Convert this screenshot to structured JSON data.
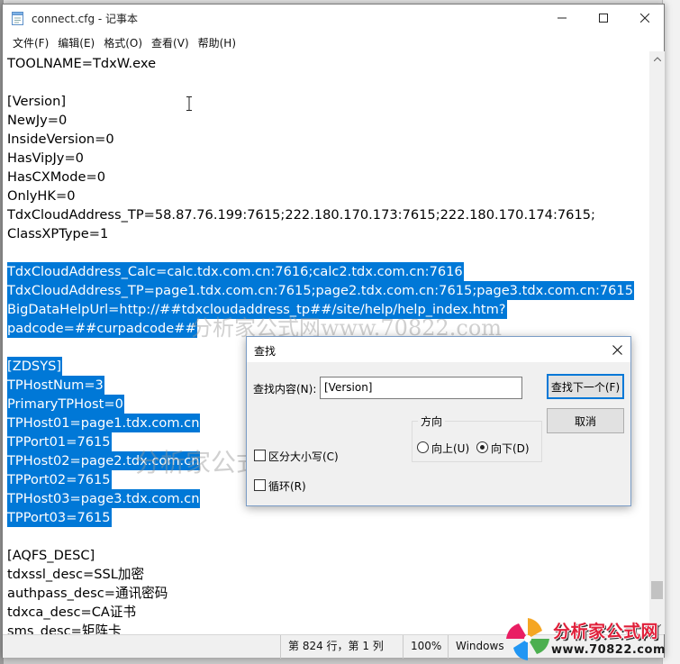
{
  "window": {
    "title": "connect.cfg - 记事本",
    "icon": "notepad-icon"
  },
  "menu": [
    {
      "label": "文件(F)"
    },
    {
      "label": "编辑(E)"
    },
    {
      "label": "格式(O)"
    },
    {
      "label": "查看(V)"
    },
    {
      "label": "帮助(H)"
    }
  ],
  "editor": {
    "lines": [
      {
        "text": "TOOLNAME=TdxW.exe",
        "selected": false
      },
      {
        "text": "",
        "selected": false
      },
      {
        "text": "[Version]",
        "selected": false
      },
      {
        "text": "NewJy=0",
        "selected": false
      },
      {
        "text": "InsideVersion=0",
        "selected": false
      },
      {
        "text": "HasVipJy=0",
        "selected": false
      },
      {
        "text": "HasCXMode=0",
        "selected": false
      },
      {
        "text": "OnlyHK=0",
        "selected": false
      },
      {
        "text": "TdxCloudAddress_TP=58.87.76.199:7615;222.180.170.173:7615;222.180.170.174:7615;",
        "selected": false
      },
      {
        "text": "ClassXPType=1",
        "selected": false
      },
      {
        "text": "",
        "selected": false
      },
      {
        "text": "TdxCloudAddress_Calc=calc.tdx.com.cn:7616;calc2.tdx.com.cn:7616",
        "selected": true
      },
      {
        "text": "TdxCloudAddress_TP=page1.tdx.com.cn:7615;page2.tdx.com.cn:7615;page3.tdx.com.cn:7615",
        "selected": true
      },
      {
        "text": "BigDataHelpUrl=http://##tdxcloudaddress_tp##/site/help/help_index.htm?",
        "selected": true
      },
      {
        "text": "padcode=##curpadcode##",
        "selected": true
      },
      {
        "text": "",
        "selected": false
      },
      {
        "text": "[ZDSYS]",
        "selected": true
      },
      {
        "text": "TPHostNum=3",
        "selected": true
      },
      {
        "text": "PrimaryTPHost=0",
        "selected": true
      },
      {
        "text": "TPHost01=page1.tdx.com.cn",
        "selected": true
      },
      {
        "text": "TPPort01=7615",
        "selected": true
      },
      {
        "text": "TPHost02=page2.tdx.com.cn",
        "selected": true
      },
      {
        "text": "TPPort02=7615",
        "selected": true
      },
      {
        "text": "TPHost03=page3.tdx.com.cn",
        "selected": true
      },
      {
        "text": "TPPort03=7615",
        "selected": true
      },
      {
        "text": "",
        "selected": false
      },
      {
        "text": "[AQFS_DESC]",
        "selected": false
      },
      {
        "text": "tdxssl_desc=SSL加密",
        "selected": false
      },
      {
        "text": "authpass_desc=通讯密码",
        "selected": false
      },
      {
        "text": "tdxca_desc=CA证书",
        "selected": false
      },
      {
        "text": "sms_desc=矩阵卡",
        "selected": false
      }
    ],
    "selection_color": "#0078d7"
  },
  "status": {
    "position": "第 824 行，第 1 列",
    "zoom": "100%",
    "encoding": "Windows"
  },
  "find_dialog": {
    "title": "查找",
    "find_label": "查找内容(N):",
    "find_value": "[Version]",
    "find_next_label": "查找下一个(F)",
    "cancel_label": "取消",
    "direction_label": "方向",
    "up_label": "向上(U)",
    "down_label": "向下(D)",
    "direction_selected": "down",
    "match_case_label": "区分大小写(C)",
    "match_case_checked": false,
    "wrap_label": "循环(R)",
    "wrap_checked": false
  },
  "watermark": {
    "text1": "分析家公式网www.70822.com",
    "text2": "分析家公式网www.70822.com"
  },
  "logo": {
    "name": "分析家公式网",
    "url": "www.70822.com",
    "color": "#e0203a"
  }
}
